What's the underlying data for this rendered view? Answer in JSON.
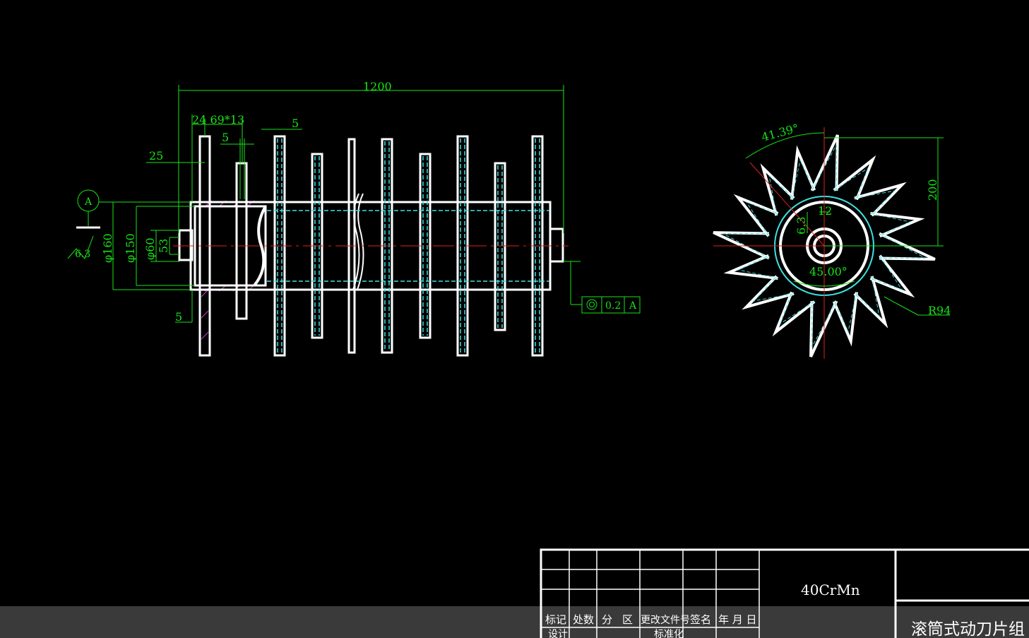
{
  "drawing": {
    "dims": {
      "total_length": "1200",
      "blade_spacing": "24 69*13",
      "blade_thickness_a": "5",
      "blade_thickness_b": "5",
      "flange_offset": "25",
      "bottom_offset": "5",
      "dia_outer": "φ160",
      "dia_tube": "φ150",
      "dia_shaft": "φ60",
      "dia_inner": "53",
      "datum": "A",
      "roughness": "6.3",
      "tolerance_value": "0.2",
      "tolerance_datum": "A",
      "angle_top": "41.39°",
      "angle_inner": "45.00°",
      "keyway": "12",
      "roughness_end": "6.3",
      "height": "200",
      "radius": "R94"
    },
    "title_block": {
      "material": "40CrMn",
      "title": "滚筒式动刀片组",
      "headers": [
        "标记",
        "处数",
        "分",
        "区",
        "更改文件号",
        "签名",
        "年 月 日"
      ],
      "row2_left": "设计",
      "row2_mid": "标准化"
    }
  },
  "colors": {
    "background": "#000000",
    "dimension": "#17e317",
    "cyan": "#3fe0e0",
    "outline": "#ffffff",
    "magenta": "#d040d0",
    "centerline": "#e02020"
  }
}
